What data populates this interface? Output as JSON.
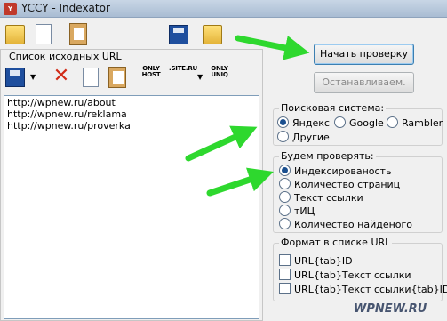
{
  "window": {
    "title": "YCCY - Indexator"
  },
  "left_panel": {
    "caption": "Список исходных URL",
    "tools": {
      "only_host": "ONLY HOST",
      "site_ru": ".SITE.RU",
      "only_uniq": "ONLY UNIQ"
    },
    "urls": [
      "http://wpnew.ru/about",
      "http://wpnew.ru/reklama",
      "http://wpnew.ru/proverka"
    ]
  },
  "buttons": {
    "start": "Начать проверку",
    "stop": "Останавливаем."
  },
  "search_group": {
    "title": "Поисковая система:",
    "options": [
      "Яндекс",
      "Google",
      "Rambler",
      "Другие"
    ],
    "selected": "Яндекс"
  },
  "check_group": {
    "title": "Будем проверять:",
    "options": [
      "Индексированость",
      "Количество страниц",
      "Текст ссылки",
      "тИЦ",
      "Количество найденого"
    ],
    "selected": "Индексированость"
  },
  "format_group": {
    "title": "Формат в списке URL",
    "options": [
      "URL{tab}ID",
      "URL{tab}Текст ссылки",
      "URL{tab}Текст ссылки{tab}ID"
    ]
  },
  "watermark": "WPNEW.RU",
  "colors": {
    "arrow": "#2ed82e",
    "accent": "#3c7fb1"
  }
}
